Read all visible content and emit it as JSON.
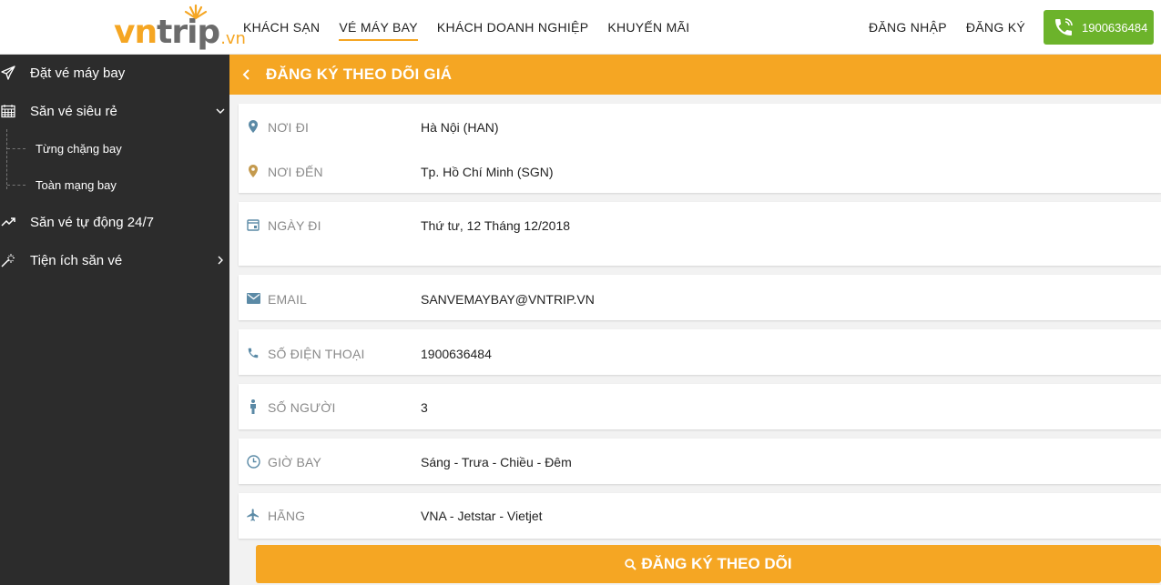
{
  "header": {
    "logo": {
      "part1": "vn",
      "part2": "trip",
      "part3": ".vn"
    },
    "nav": [
      {
        "label": "KHÁCH SẠN",
        "active": false
      },
      {
        "label": "VÉ MÁY BAY",
        "active": true
      },
      {
        "label": "KHÁCH DOANH NGHIỆP",
        "active": false
      },
      {
        "label": "KHUYẾN MÃI",
        "active": false
      }
    ],
    "login_label": "ĐĂNG NHẬP",
    "register_label": "ĐĂNG KÝ",
    "hotline": {
      "icon": "phone-icon",
      "number": "1900636484"
    }
  },
  "sidebar": {
    "items": [
      {
        "label": "Đặt vé máy bay",
        "icon": "paper-plane-icon"
      },
      {
        "label": "Săn vé siêu rẻ",
        "icon": "calendar-grid-icon",
        "chevron": "chevron-down-icon"
      },
      {
        "label": "Săn vé tự động 24/7",
        "icon": "trending-up-icon"
      },
      {
        "label": "Tiện ích săn vé",
        "icon": "magic-wand-icon",
        "chevron": "chevron-right-icon"
      }
    ],
    "subitems": [
      {
        "label": "Từng chặng bay"
      },
      {
        "label": "Toàn mạng bay"
      }
    ]
  },
  "page": {
    "title": "ĐĂNG KÝ THEO DÕI GIÁ",
    "fields": {
      "origin": {
        "label": "NƠI ĐI",
        "value": "Hà Nội (HAN)",
        "icon": "location-pin-icon"
      },
      "destination": {
        "label": "NƠI ĐẾN",
        "value": "Tp. Hồ Chí Minh (SGN)",
        "icon": "location-pin-icon"
      },
      "date": {
        "label": "NGÀY ĐI",
        "value": "Thứ tư, 12 Tháng 12/2018",
        "icon": "calendar-icon"
      },
      "email": {
        "label": "EMAIL",
        "value": "SANVEMAYBAY@VNTRIP.VN",
        "icon": "mail-icon"
      },
      "phone": {
        "label": "SỐ ĐIỆN THOẠI",
        "value": "1900636484",
        "icon": "phone-icon"
      },
      "passengers": {
        "label": "SỐ NGƯỜI",
        "value": "3",
        "icon": "person-icon"
      },
      "flight_time": {
        "label": "GIỜ BAY",
        "value": "Sáng - Trưa - Chiều - Đêm",
        "icon": "clock-icon"
      },
      "airline": {
        "label": "HÃNG",
        "value": "VNA - Jetstar - Vietjet",
        "icon": "airplane-icon"
      }
    },
    "submit_label": "ĐĂNG KÝ THEO DÕI"
  },
  "colors": {
    "accent": "#f5a623",
    "sidebar_bg": "#2c2c2c",
    "hotline_bg": "#6cb32b",
    "icon_blue": "#5b8aa6",
    "icon_gold": "#c49a4e"
  }
}
